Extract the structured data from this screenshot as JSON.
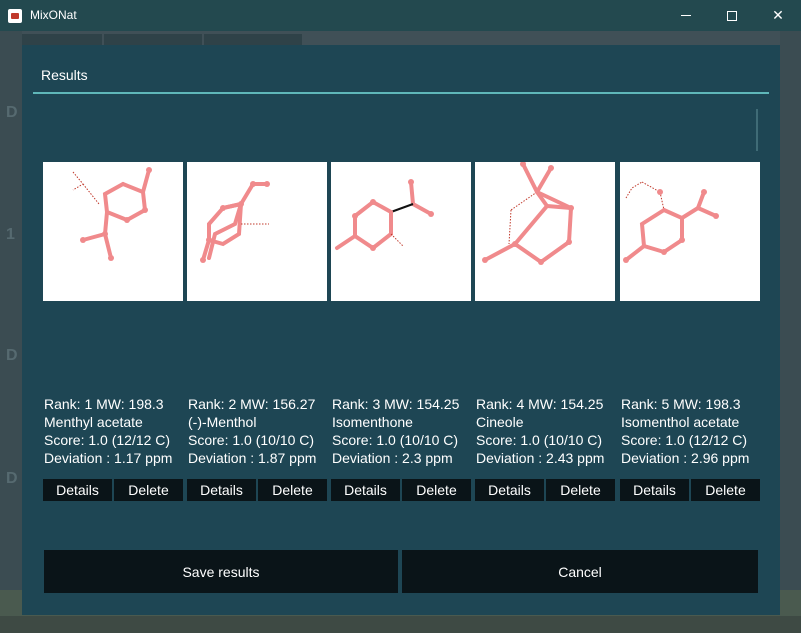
{
  "window": {
    "title": "MixONat",
    "minimize_glyph": "—",
    "close_glyph": "✕"
  },
  "dialog": {
    "title": "Results",
    "save_label": "Save results",
    "cancel_label": "Cancel"
  },
  "results": [
    {
      "rank_line": "Rank: 1 MW: 198.3",
      "name": "Menthyl acetate",
      "score_line": "Score: 1.0 (12/12 C)",
      "deviation_line": "Deviation : 1.17 ppm",
      "details_label": "Details",
      "delete_label": "Delete"
    },
    {
      "rank_line": "Rank: 2 MW: 156.27",
      "name": "(-)-Menthol",
      "score_line": "Score: 1.0 (10/10 C)",
      "deviation_line": "Deviation : 1.87 ppm",
      "details_label": "Details",
      "delete_label": "Delete"
    },
    {
      "rank_line": "Rank: 3 MW: 154.25",
      "name": "Isomenthone",
      "score_line": "Score: 1.0 (10/10 C)",
      "deviation_line": "Deviation : 2.3 ppm",
      "details_label": "Details",
      "delete_label": "Delete"
    },
    {
      "rank_line": "Rank: 4 MW: 154.25",
      "name": "Cineole",
      "score_line": "Score: 1.0 (10/10 C)",
      "deviation_line": "Deviation : 2.43 ppm",
      "details_label": "Details",
      "delete_label": "Delete"
    },
    {
      "rank_line": "Rank: 5 MW: 198.3",
      "name": "Isomenthol acetate",
      "score_line": "Score: 1.0 (12/12 C)",
      "deviation_line": "Deviation : 2.96 ppm",
      "details_label": "Details",
      "delete_label": "Delete"
    }
  ],
  "background": {
    "letters": [
      "D",
      "1",
      "D",
      "D"
    ]
  },
  "colors": {
    "dialog_bg": "#1e4654",
    "titlebar_bg": "#23494f",
    "accent_rule": "#5fb7b9",
    "button_bg": "#0a1418",
    "bond_color": "#f08a8c"
  }
}
